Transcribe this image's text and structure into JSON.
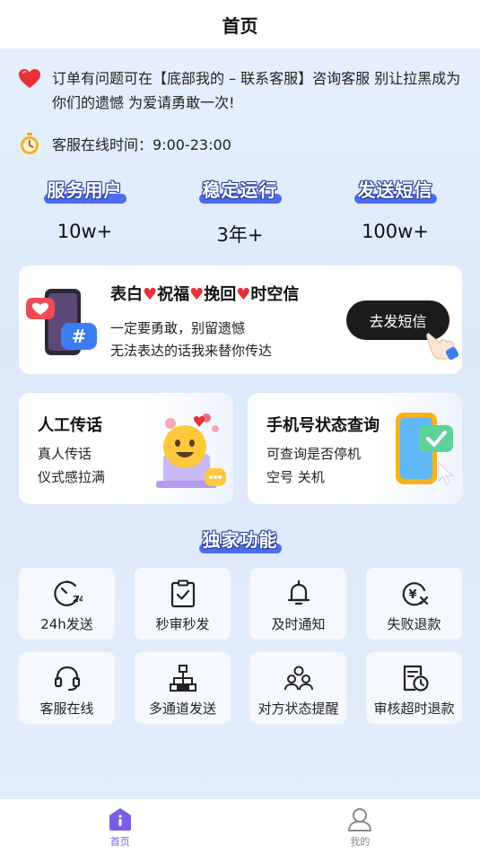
{
  "header": {
    "title": "首页"
  },
  "notice": {
    "text": "订单有问题可在【底部我的 – 联系客服】咨询客服 别让拉黑成为你们的遗憾 为爱请勇敢一次!",
    "service_hours": "客服在线时间：9:00-23:00"
  },
  "stats": [
    {
      "label": "服务用户",
      "value": "10w+"
    },
    {
      "label": "稳定运行",
      "value": "3年+"
    },
    {
      "label": "发送短信",
      "value": "100w+"
    }
  ],
  "banner": {
    "title_parts": [
      "表白",
      "祝福",
      "挽回",
      "时空信"
    ],
    "line1": "一定要勇敢，别留遗憾",
    "line2": "无法表达的话我来替你传达",
    "button": "去发短信"
  },
  "cards": [
    {
      "title": "人工传话",
      "line1": "真人传话",
      "line2": "仪式感拉满"
    },
    {
      "title": "手机号状态查询",
      "line1": "可查询是否停机",
      "line2": "空号 关机"
    }
  ],
  "features_title": "独家功能",
  "features": [
    {
      "label": "24h发送",
      "icon": "clock-24h-icon"
    },
    {
      "label": "秒审秒发",
      "icon": "clipboard-check-icon"
    },
    {
      "label": "及时通知",
      "icon": "bell-icon"
    },
    {
      "label": "失败退款",
      "icon": "refund-yen-icon"
    },
    {
      "label": "客服在线",
      "icon": "headset-icon"
    },
    {
      "label": "多通道发送",
      "icon": "network-icon"
    },
    {
      "label": "对方状态提醒",
      "icon": "users-icon"
    },
    {
      "label": "审核超时退款",
      "icon": "timeout-document-icon"
    }
  ],
  "tabbar": {
    "home": "首页",
    "me": "我的"
  },
  "colors": {
    "accent": "#4d6df0",
    "tab_active": "#7b5ce6",
    "heart": "#e8303a"
  }
}
